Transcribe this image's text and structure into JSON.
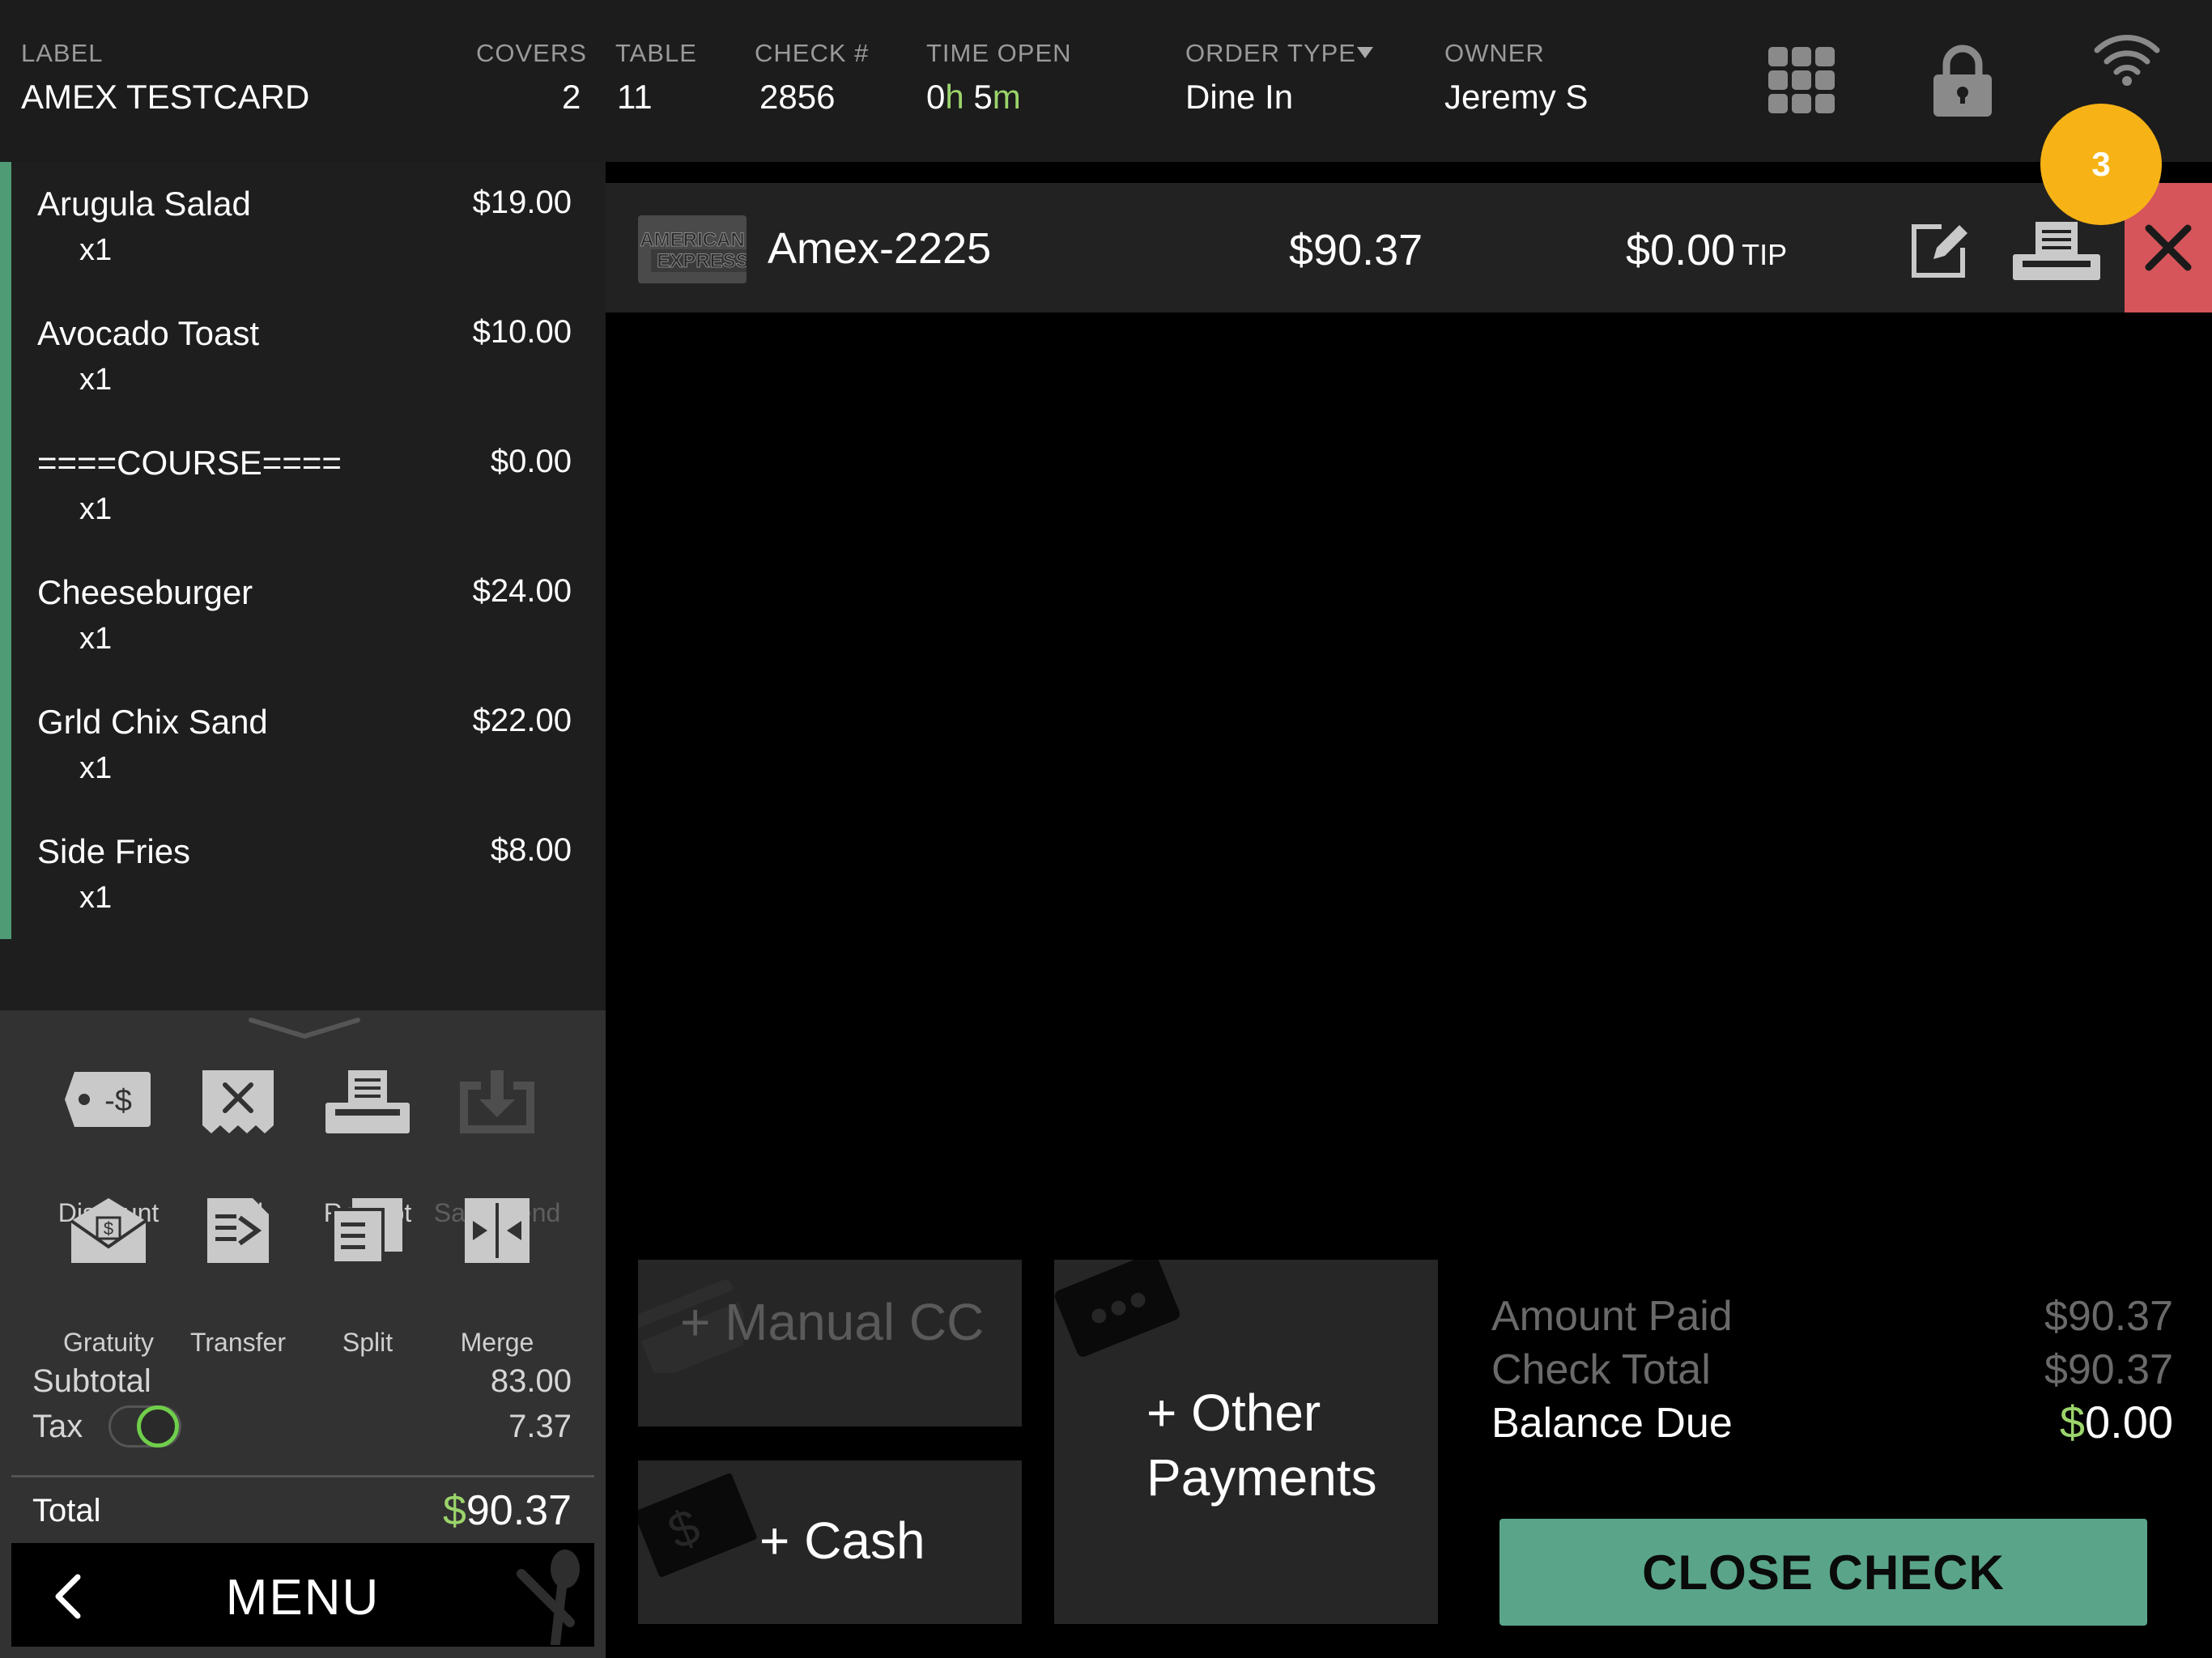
{
  "header": {
    "label_title": "LABEL",
    "label_value": "AMEX TESTCARD",
    "covers_title": "COVERS",
    "covers_value": "2",
    "table_title": "TABLE",
    "table_value": "11",
    "check_title": "CHECK #",
    "check_value": "2856",
    "time_title": "TIME OPEN",
    "time_hours": "0",
    "time_h": "h",
    "time_minutes": "5",
    "time_m": "m",
    "ordertype_title": "ORDER TYPE",
    "ordertype_value": "Dine In",
    "owner_title": "OWNER",
    "owner_value": "Jeremy S",
    "badge_count": "3"
  },
  "order": {
    "items": [
      {
        "name": "Arugula Salad",
        "qty": "x1",
        "price": "$19.00"
      },
      {
        "name": "Avocado Toast",
        "qty": "x1",
        "price": "$10.00"
      },
      {
        "name": "====COURSE====",
        "qty": "x1",
        "price": "$0.00"
      },
      {
        "name": "Cheeseburger",
        "qty": "x1",
        "price": "$24.00"
      },
      {
        "name": "Grld Chix Sand",
        "qty": "x1",
        "price": "$22.00"
      },
      {
        "name": "Side Fries",
        "qty": "x1",
        "price": "$8.00"
      }
    ]
  },
  "actions": {
    "discount": "Discount",
    "discount_glyph": "-$",
    "void": "Void",
    "receipt": "Receipt",
    "save_send": "Save/Send",
    "gratuity": "Gratuity",
    "transfer": "Transfer",
    "split": "Split",
    "merge": "Merge"
  },
  "totals": {
    "subtotal_label": "Subtotal",
    "subtotal_value": "83.00",
    "tax_label": "Tax",
    "tax_value": "7.37",
    "total_label": "Total",
    "total_currency": "$",
    "total_value": "90.37"
  },
  "menu_bar": {
    "label": "MENU"
  },
  "payment": {
    "card_logo_line1": "AMERICAN",
    "card_logo_line2": "EXPRESS",
    "name": "Amex-2225",
    "amount": "$90.37",
    "tip": "$0.00",
    "tip_label": "TIP"
  },
  "buttons": {
    "manual_cc": "+ Manual CC",
    "cash": "+ Cash",
    "other_line1": "+ Other",
    "other_line2": "Payments",
    "close_check": "CLOSE CHECK"
  },
  "summary": {
    "amount_paid_label": "Amount Paid",
    "amount_paid_value": "$90.37",
    "check_total_label": "Check Total",
    "check_total_value": "$90.37",
    "balance_due_label": "Balance Due",
    "balance_currency": "$",
    "balance_value": "0.00"
  },
  "colors": {
    "accent_green": "#5aa58a",
    "time_green": "#9bd46b",
    "remove_red": "#d5555a",
    "badge_orange": "#f7b316"
  }
}
